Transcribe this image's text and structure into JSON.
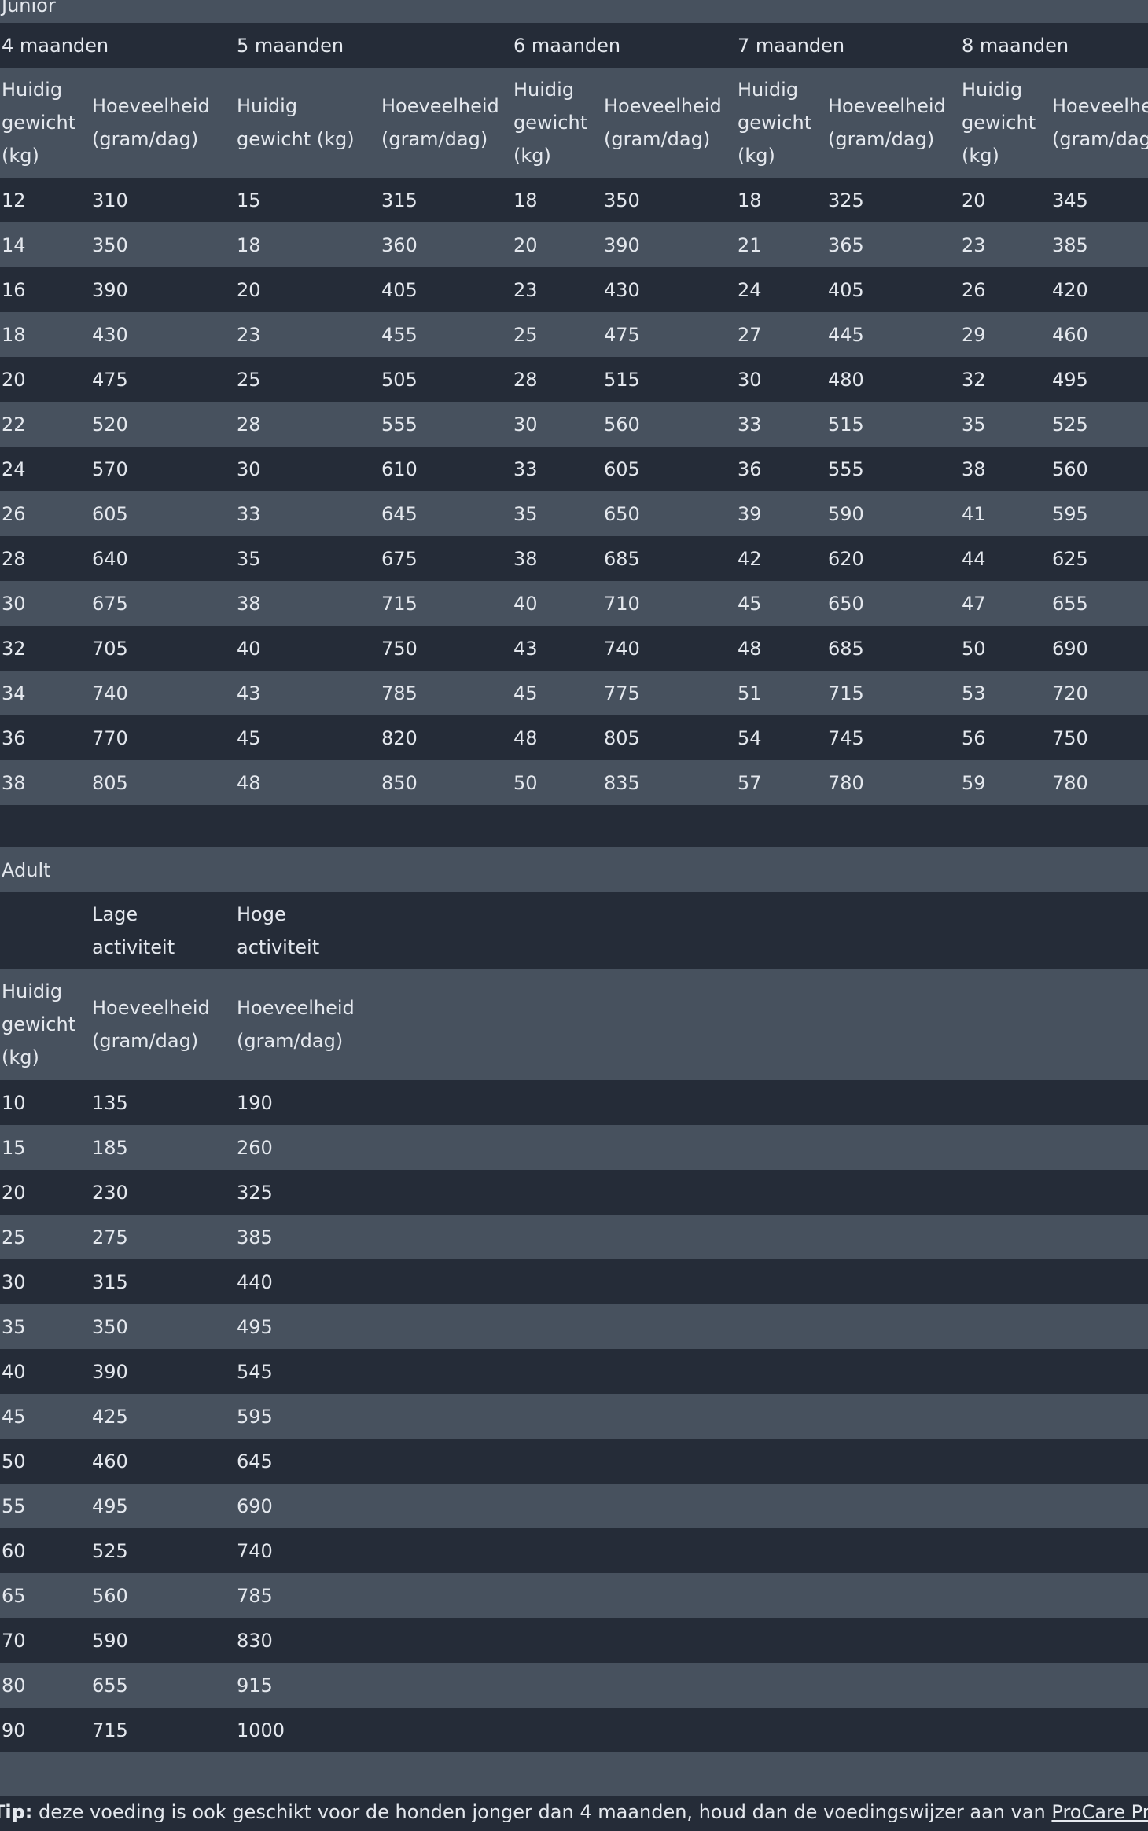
{
  "junior": {
    "title": "Junior",
    "months": [
      "4 maanden",
      "5 maanden",
      "6 maanden",
      "7 maanden",
      "8 maanden"
    ],
    "col_weight": [
      "Huidig",
      "gewicht",
      "(kg)"
    ],
    "col_weight_one_line_a": "Huidig",
    "col_weight_one_line_b": "gewicht (kg)",
    "col_amount_a": "Hoeveelheid",
    "col_amount_b": "(gram/dag)",
    "col_amount_cut_a": "Hoeveelhei",
    "col_amount_cut_b": "(gram/dag)",
    "rows": [
      [
        "12",
        "310",
        "15",
        "315",
        "18",
        "350",
        "18",
        "325",
        "20",
        "345"
      ],
      [
        "14",
        "350",
        "18",
        "360",
        "20",
        "390",
        "21",
        "365",
        "23",
        "385"
      ],
      [
        "16",
        "390",
        "20",
        "405",
        "23",
        "430",
        "24",
        "405",
        "26",
        "420"
      ],
      [
        "18",
        "430",
        "23",
        "455",
        "25",
        "475",
        "27",
        "445",
        "29",
        "460"
      ],
      [
        "20",
        "475",
        "25",
        "505",
        "28",
        "515",
        "30",
        "480",
        "32",
        "495"
      ],
      [
        "22",
        "520",
        "28",
        "555",
        "30",
        "560",
        "33",
        "515",
        "35",
        "525"
      ],
      [
        "24",
        "570",
        "30",
        "610",
        "33",
        "605",
        "36",
        "555",
        "38",
        "560"
      ],
      [
        "26",
        "605",
        "33",
        "645",
        "35",
        "650",
        "39",
        "590",
        "41",
        "595"
      ],
      [
        "28",
        "640",
        "35",
        "675",
        "38",
        "685",
        "42",
        "620",
        "44",
        "625"
      ],
      [
        "30",
        "675",
        "38",
        "715",
        "40",
        "710",
        "45",
        "650",
        "47",
        "655"
      ],
      [
        "32",
        "705",
        "40",
        "750",
        "43",
        "740",
        "48",
        "685",
        "50",
        "690"
      ],
      [
        "34",
        "740",
        "43",
        "785",
        "45",
        "775",
        "51",
        "715",
        "53",
        "720"
      ],
      [
        "36",
        "770",
        "45",
        "820",
        "48",
        "805",
        "54",
        "745",
        "56",
        "750"
      ],
      [
        "38",
        "805",
        "48",
        "850",
        "50",
        "835",
        "57",
        "780",
        "59",
        "780"
      ]
    ]
  },
  "adult": {
    "title": "Adult",
    "low_a": "Lage",
    "low_b": "activiteit",
    "high_a": "Hoge",
    "high_b": "activiteit",
    "col_weight": [
      "Huidig",
      "gewicht",
      "(kg)"
    ],
    "col_amount_a": "Hoeveelheid",
    "col_amount_b": "(gram/dag)",
    "rows": [
      [
        "10",
        "135",
        "190"
      ],
      [
        "15",
        "185",
        "260"
      ],
      [
        "20",
        "230",
        "325"
      ],
      [
        "25",
        "275",
        "385"
      ],
      [
        "30",
        "315",
        "440"
      ],
      [
        "35",
        "350",
        "495"
      ],
      [
        "40",
        "390",
        "545"
      ],
      [
        "45",
        "425",
        "595"
      ],
      [
        "50",
        "460",
        "645"
      ],
      [
        "55",
        "495",
        "690"
      ],
      [
        "60",
        "525",
        "740"
      ],
      [
        "65",
        "560",
        "785"
      ],
      [
        "70",
        "590",
        "830"
      ],
      [
        "80",
        "655",
        "915"
      ],
      [
        "90",
        "715",
        "1000"
      ]
    ]
  },
  "tip": {
    "label": "Tip:",
    "text": " deze voeding is ook geschikt voor de honden jonger dan 4 maanden, houd dan de voedingswijzer aan van ",
    "link": "ProCare Protection"
  },
  "colors": {
    "row_dark": "#252c38",
    "row_light": "#47515e",
    "text": "#e4e8ee"
  }
}
